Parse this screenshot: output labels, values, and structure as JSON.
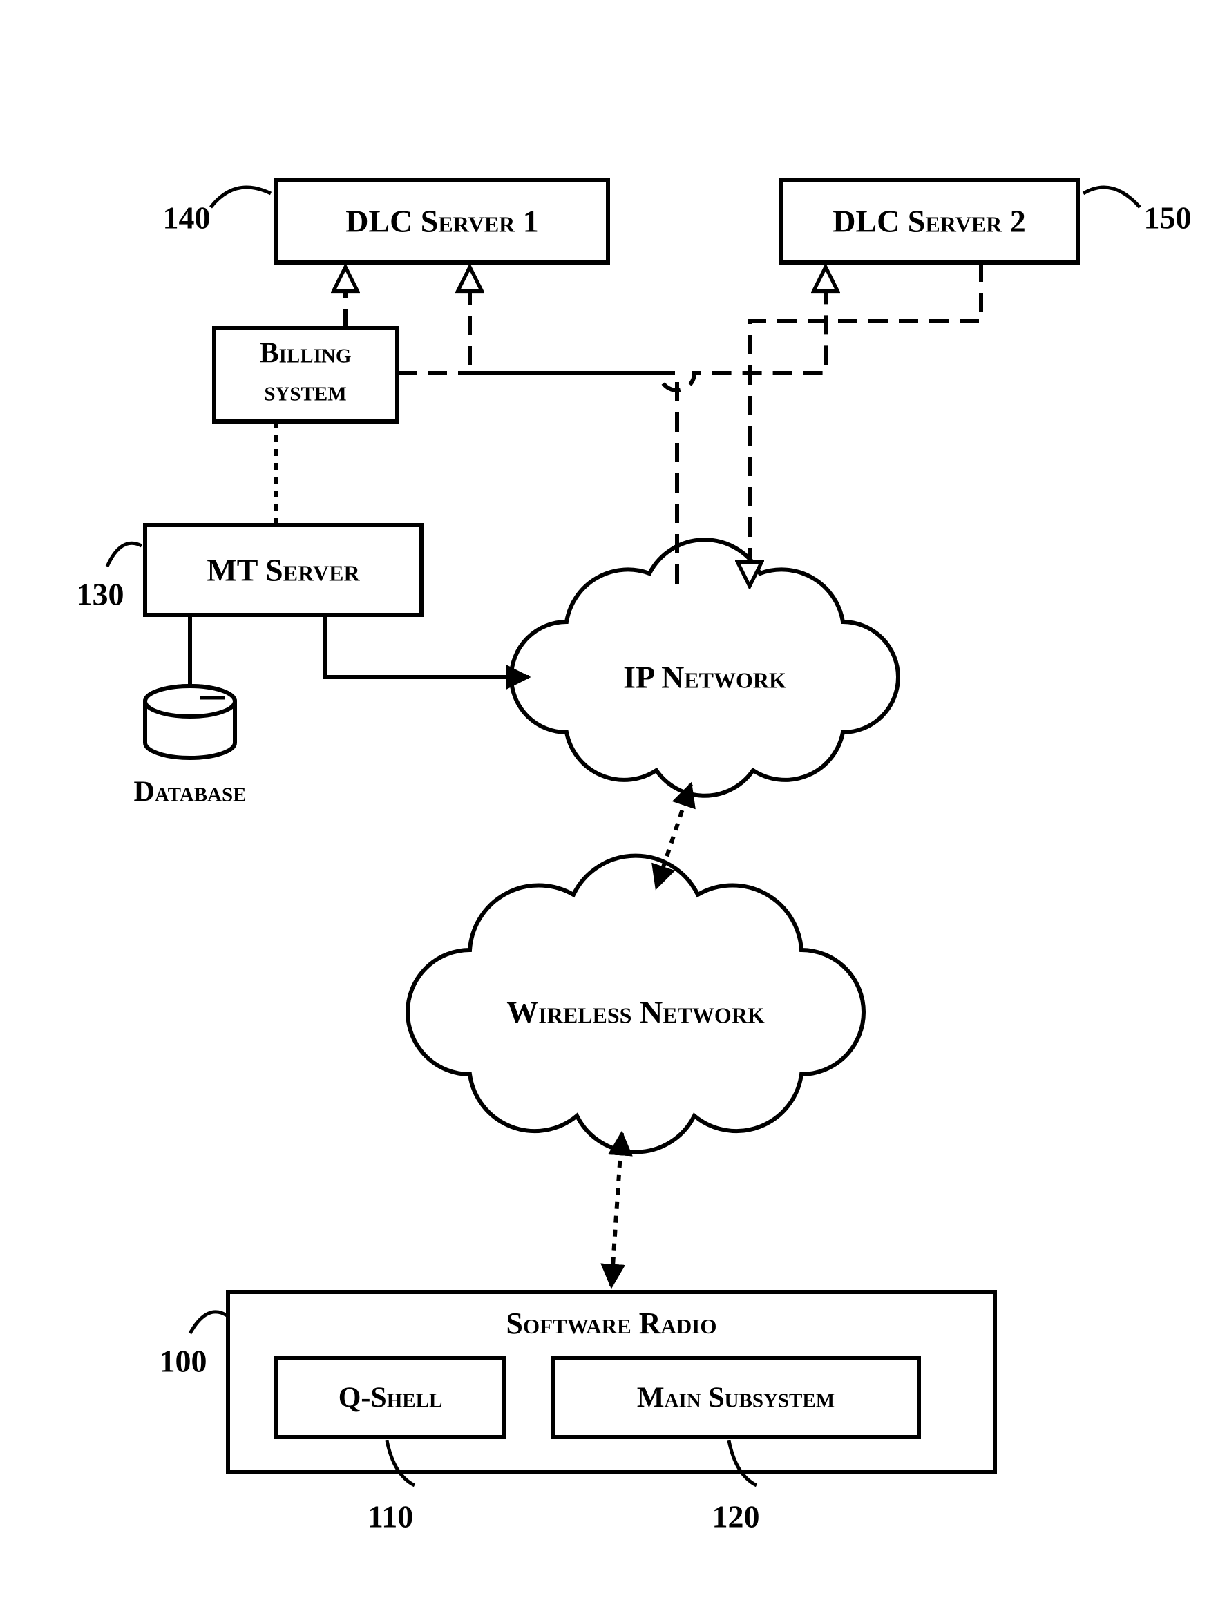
{
  "boxes": {
    "dlc1": "DLC Server 1",
    "dlc2": "DLC Server 2",
    "billing1": "Billing",
    "billing2": "system",
    "mt": "MT Server",
    "ip": "IP Network",
    "wireless": "Wireless Network",
    "sw": "Software  Radio",
    "qshell": "Q-Shell",
    "mainsub": "Main Subsystem",
    "db": "Database"
  },
  "refs": {
    "r140": "140",
    "r150": "150",
    "r130": "130",
    "r100": "100",
    "r110": "110",
    "r120": "120"
  }
}
